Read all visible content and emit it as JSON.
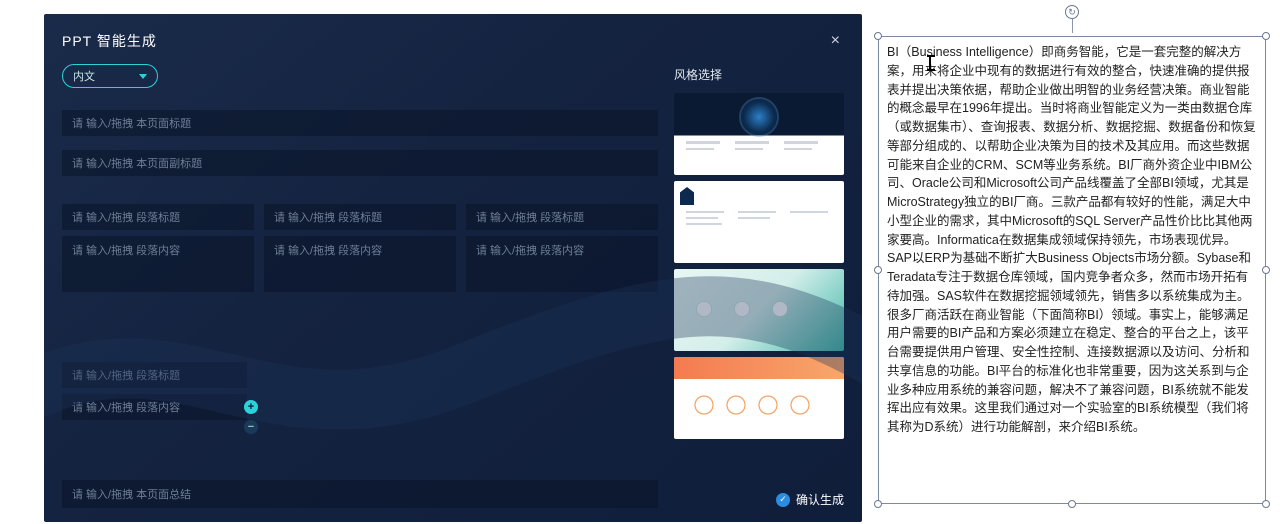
{
  "dialog": {
    "title": "PPT 智能生成",
    "close_label": "×",
    "dropdown": {
      "selected": "内文"
    },
    "placeholders": {
      "page_title": "请 输入/拖拽 本页面标题",
      "page_subtitle": "请 输入/拖拽 本页面副标题",
      "section_title": "请 输入/拖拽 段落标题",
      "section_body": "请 输入/拖拽 段落内容",
      "page_summary": "请 输入/拖拽 本页面总结"
    },
    "buttons": {
      "add": "+",
      "remove": "−"
    },
    "style_panel": {
      "heading": "风格选择",
      "confirm": "确认生成",
      "templates": [
        "dark-globe",
        "shield-white",
        "teal-badges",
        "orange-hex"
      ]
    }
  },
  "text_box": {
    "content": "BI（Business Intelligence）即商务智能，它是一套完整的解决方案，用来将企业中现有的数据进行有效的整合，快速准确的提供报表并提出决策依据，帮助企业做出明智的业务经营决策。商业智能的概念最早在1996年提出。当时将商业智能定义为一类由数据仓库（或数据集市）、查询报表、数据分析、数据挖掘、数据备份和恢复等部分组成的、以帮助企业决策为目的技术及其应用。而这些数据可能来自企业的CRM、SCM等业务系统。BI厂商外资企业中IBM公司、Oracle公司和Microsoft公司产品线覆盖了全部BI领域，尤其是MicroStrategy独立的BI厂商。三款产品都有较好的性能，满足大中小型企业的需求，其中Microsoft的SQL Server产品性价比比其他两家要高。Informatica在数据集成领域保持领先，市场表现优异。SAP以ERP为基础不断扩大Business Objects市场分额。Sybase和Teradata专注于数据仓库领域，国内竞争者众多，然而市场开拓有待加强。SAS软件在数据挖掘领域领先，销售多以系统集成为主。很多厂商活跃在商业智能（下面简称BI）领域。事实上，能够满足用户需要的BI产品和方案必须建立在稳定、整合的平台之上，该平台需要提供用户管理、安全性控制、连接数据源以及访问、分析和共享信息的功能。BI平台的标准化也非常重要，因为这关系到与企业多种应用系统的兼容问题，解决不了兼容问题，BI系统就不能发挥出应有效果。这里我们通过对一个实验室的BI系统模型（我们将其称为D系统）进行功能解剖，来介绍BI系统。"
  }
}
